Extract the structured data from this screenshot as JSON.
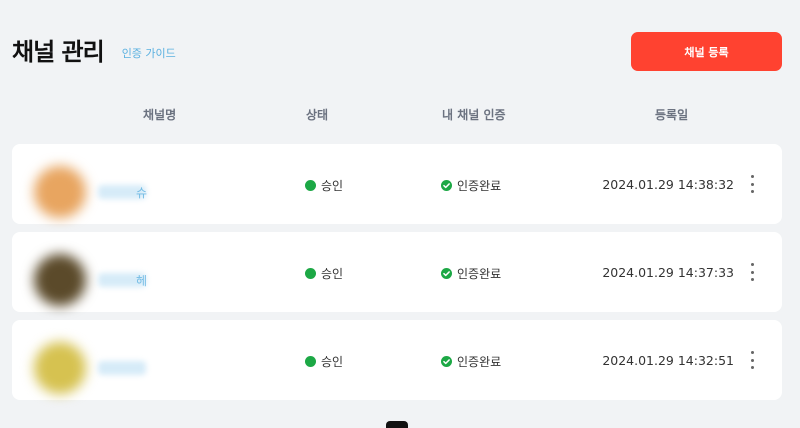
{
  "header": {
    "title": "채널 관리",
    "guide_link": "인증 가이드",
    "register_button": "채널 등록"
  },
  "table": {
    "columns": [
      "채널명",
      "상태",
      "내 채널 인증",
      "등록일"
    ],
    "rows": [
      {
        "name_partial": "슈",
        "avatar_color": "#e8a560",
        "status": "승인",
        "verification": "인증완료",
        "date": "2024.01.29 14:38:32"
      },
      {
        "name_partial": "헤",
        "avatar_color": "#5b4a2a",
        "status": "승인",
        "verification": "인증완료",
        "date": "2024.01.29 14:37:33"
      },
      {
        "name_partial": "",
        "avatar_color": "#d6c250",
        "status": "승인",
        "verification": "인증완료",
        "date": "2024.01.29 14:32:51"
      }
    ]
  },
  "colors": {
    "accent": "#ff4230",
    "approved": "#1ca845",
    "link": "#5ab0e0"
  }
}
